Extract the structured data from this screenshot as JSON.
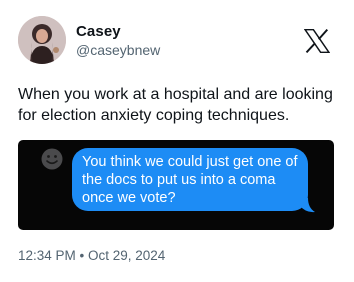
{
  "post": {
    "author_name": "Casey",
    "author_handle": "@caseybnew",
    "text": "When you work at a hospital and are looking for election anxiety coping techniques.",
    "timestamp": "12:34 PM • Oct 29, 2024"
  },
  "media": {
    "message_text": "You think we could just get one of the docs to put us into a coma once we vote?",
    "bubble_color": "#1d8cf5",
    "background_color": "#060606"
  },
  "icons": {
    "brand": "x-logo-icon",
    "input": "emoji-icon"
  },
  "colors": {
    "text_primary": "#0f1419",
    "text_secondary": "#536471"
  }
}
